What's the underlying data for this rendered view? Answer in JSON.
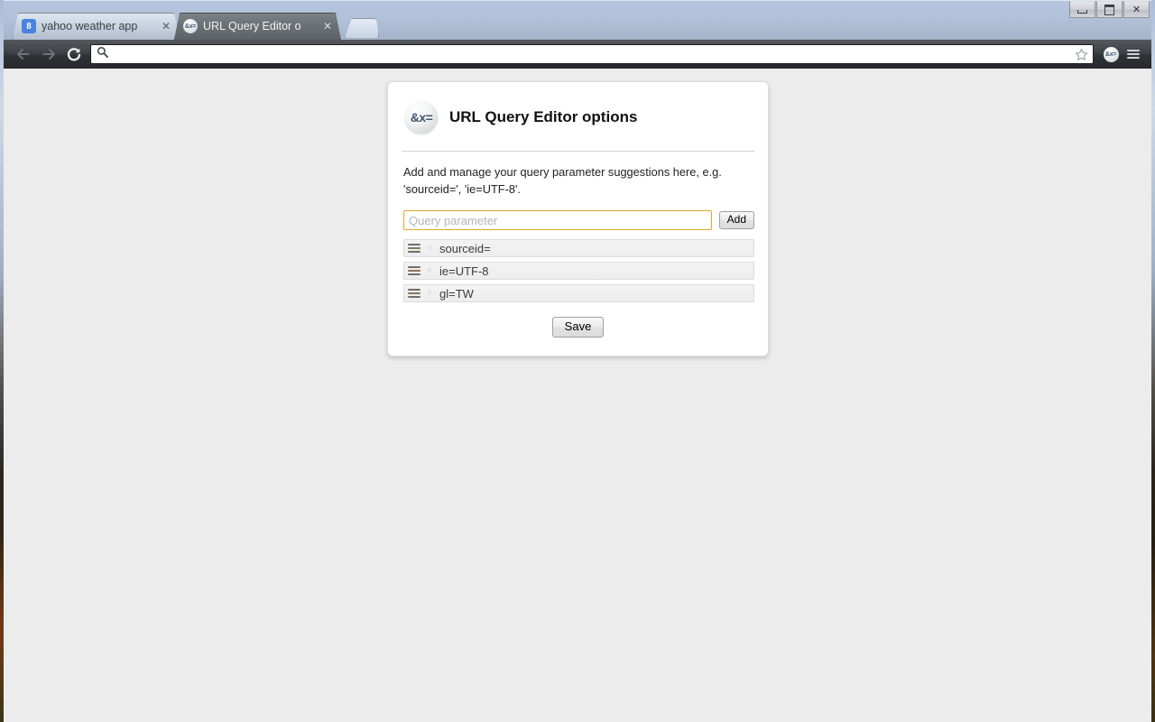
{
  "window": {
    "controls": {
      "minimize_label": "Minimize",
      "maximize_label": "Maximize",
      "close_label": "✕"
    }
  },
  "tabs": [
    {
      "title": "yahoo weather app",
      "favicon": "google-favicon",
      "favicon_text": "8",
      "close_label": "✕",
      "active": false
    },
    {
      "title": "URL Query Editor o",
      "favicon": "url-query-editor-favicon",
      "favicon_text": "&x=",
      "close_label": "✕",
      "active": true
    }
  ],
  "new_tab": {
    "label": "New Tab"
  },
  "toolbar": {
    "back_label": "Back",
    "forward_label": "Forward",
    "reload_label": "Reload",
    "omnibox_value": "",
    "omnibox_placeholder": "",
    "star_label": "Bookmark this page",
    "extension_icon_text": "&x=",
    "extension_label": "URL Query Editor",
    "menu_label": "Customize and control Google Chrome"
  },
  "options_page": {
    "logo_text": "&x=",
    "title": "URL Query Editor options",
    "description": "Add and manage your query parameter suggestions here, e.g. 'sourceid=', 'ie=UTF-8'.",
    "input_value": "",
    "input_placeholder": "Query parameter",
    "add_button_label": "Add",
    "save_button_label": "Save",
    "parameters": [
      {
        "value": "sourceid=",
        "delete_label": "×"
      },
      {
        "value": "ie=UTF-8",
        "delete_label": "×"
      },
      {
        "value": "gl=TW",
        "delete_label": "×"
      }
    ]
  },
  "colors": {
    "accent_focus_border": "#e0a62e",
    "page_background": "#ececec",
    "card_background": "#ffffff",
    "logo_text_color": "#3c5770"
  }
}
